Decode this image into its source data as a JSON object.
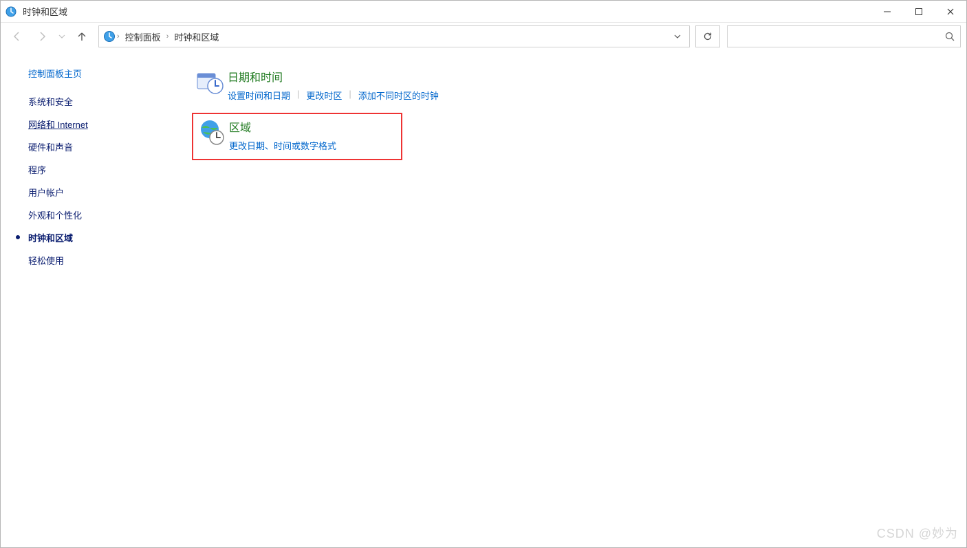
{
  "window": {
    "title": "时钟和区域",
    "watermark": "CSDN @妙为"
  },
  "breadcrumb": {
    "items": [
      "控制面板",
      "时钟和区域"
    ]
  },
  "sidebar": {
    "home_label": "控制面板主页",
    "items": [
      {
        "label": "系统和安全"
      },
      {
        "label": "网络和 Internet",
        "underline": true
      },
      {
        "label": "硬件和声音"
      },
      {
        "label": "程序"
      },
      {
        "label": "用户帐户"
      },
      {
        "label": "外观和个性化"
      },
      {
        "label": "时钟和区域",
        "active": true
      },
      {
        "label": "轻松使用"
      }
    ]
  },
  "categories": {
    "datetime": {
      "title": "日期和时间",
      "links": [
        "设置时间和日期",
        "更改时区",
        "添加不同时区的时钟"
      ]
    },
    "region": {
      "title": "区域",
      "links": [
        "更改日期、时间或数字格式"
      ]
    }
  },
  "search": {
    "placeholder": ""
  }
}
